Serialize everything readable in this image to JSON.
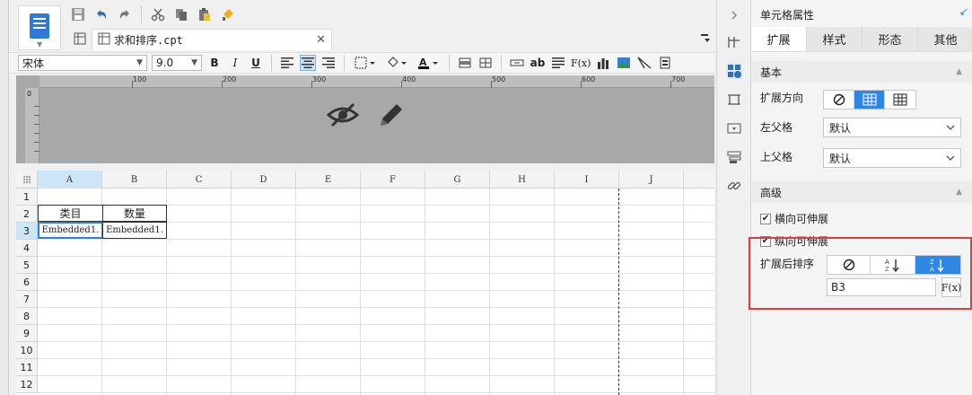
{
  "toolbar": {
    "icons": [
      "save-icon",
      "undo-icon",
      "redo-icon",
      "cut-icon",
      "copy-icon",
      "paste-icon",
      "format-painter-icon"
    ]
  },
  "tab": {
    "label": "求和排序.cpt"
  },
  "format": {
    "font": "宋体",
    "size": "9.0",
    "bold": "B",
    "italic": "I",
    "underline": "U",
    "text_label": "ab",
    "fx": "F(x)"
  },
  "ruler": {
    "marks": [
      "100",
      "200",
      "300",
      "400",
      "500",
      "600",
      "700"
    ],
    "vertical_start": "0"
  },
  "grid": {
    "columns": [
      "A",
      "B",
      "C",
      "D",
      "E",
      "F",
      "G",
      "H",
      "I",
      "J"
    ],
    "rows": [
      "1",
      "2",
      "3",
      "4",
      "5",
      "6",
      "7",
      "8",
      "9",
      "10",
      "11",
      "12"
    ],
    "selected_column": "A",
    "selected_row": "3",
    "cells": {
      "A2": "类目",
      "B2": "数量",
      "A3": "Embedded1.",
      "B3": "Embedded1."
    }
  },
  "panel": {
    "title": "单元格属性",
    "tabs": [
      "扩展",
      "样式",
      "形态",
      "其他"
    ],
    "active_tab": "扩展",
    "section_basic": "基本",
    "expand_direction_label": "扩展方向",
    "left_parent_label": "左父格",
    "left_parent_value": "默认",
    "upper_parent_label": "上父格",
    "upper_parent_value": "默认",
    "section_advanced": "高级",
    "horizontal_expand_label": "横向可伸展",
    "vertical_expand_label": "纵向可伸展",
    "sort_label": "扩展后排序",
    "sort_formula": "B3",
    "fx": "F(x)"
  },
  "colors": {
    "accent": "#2f86e5",
    "highlight_box": "#e23b3b",
    "selected_header": "#cde6f7"
  }
}
